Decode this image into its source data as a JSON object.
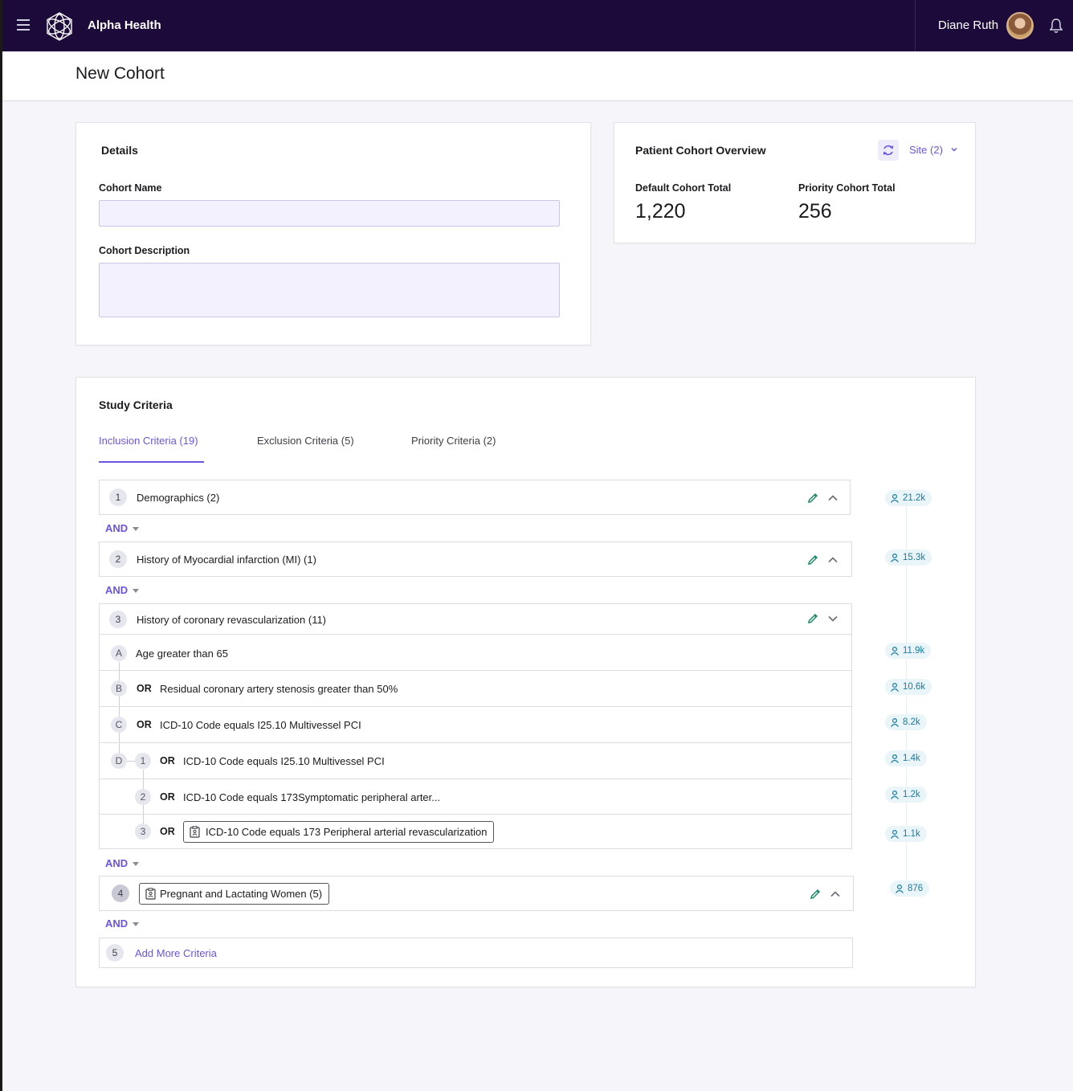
{
  "app": {
    "name": "Alpha Health",
    "user": "Diane Ruth"
  },
  "page": {
    "title": "New Cohort"
  },
  "details": {
    "title": "Details",
    "cohort_name_label": "Cohort Name",
    "cohort_name_value": "",
    "cohort_description_label": "Cohort Description",
    "cohort_description_value": ""
  },
  "overview": {
    "title": "Patient Cohort Overview",
    "site_label": "Site (2)",
    "default_total_label": "Default Cohort Total",
    "default_total_value": "1,220",
    "priority_total_label": "Priority Cohort Total",
    "priority_total_value": "256"
  },
  "study": {
    "title": "Study Criteria",
    "tabs": [
      {
        "label": "Inclusion Criteria (19)",
        "active": true
      },
      {
        "label": "Exclusion Criteria (5)",
        "active": false
      },
      {
        "label": "Priority Criteria (2)",
        "active": false
      }
    ],
    "and_label": "AND",
    "or_label": "OR",
    "groups": [
      {
        "num": "1",
        "label": "Demographics (2)",
        "count": "21.2k"
      },
      {
        "num": "2",
        "label": "History of Myocardial infarction (MI) (1)",
        "count": "15.3k"
      },
      {
        "num": "3",
        "label": "History of coronary revascularization (11)"
      },
      {
        "num": "4",
        "label": "Pregnant and Lactating Women (5)",
        "count": "876"
      }
    ],
    "sub_items": [
      {
        "letter": "A",
        "label": "Age greater than 65",
        "count": "11.9k"
      },
      {
        "letter": "B",
        "label": "Residual coronary artery stenosis greater than 50%",
        "count": "10.6k"
      },
      {
        "letter": "C",
        "label": "ICD-10 Code equals I25.10 Multivessel PCI",
        "count": "8.2k"
      },
      {
        "letter": "D",
        "num": "1",
        "label": "ICD-10 Code equals I25.10 Multivessel PCI",
        "count": "1.4k"
      },
      {
        "num": "2",
        "label": "ICD-10 Code equals 173Symptomatic peripheral arter...",
        "count": "1.2k"
      },
      {
        "num": "3",
        "label": "ICD-10 Code equals 173 Peripheral arterial revascularization",
        "count": "1.1k"
      }
    ],
    "add_more": {
      "num": "5",
      "label": "Add More Criteria"
    }
  },
  "colors": {
    "topbar": "#1b0a3a",
    "accent": "#6b55e0",
    "edit_icon": "#1f8a6a",
    "count_text": "#1a7aa0"
  }
}
